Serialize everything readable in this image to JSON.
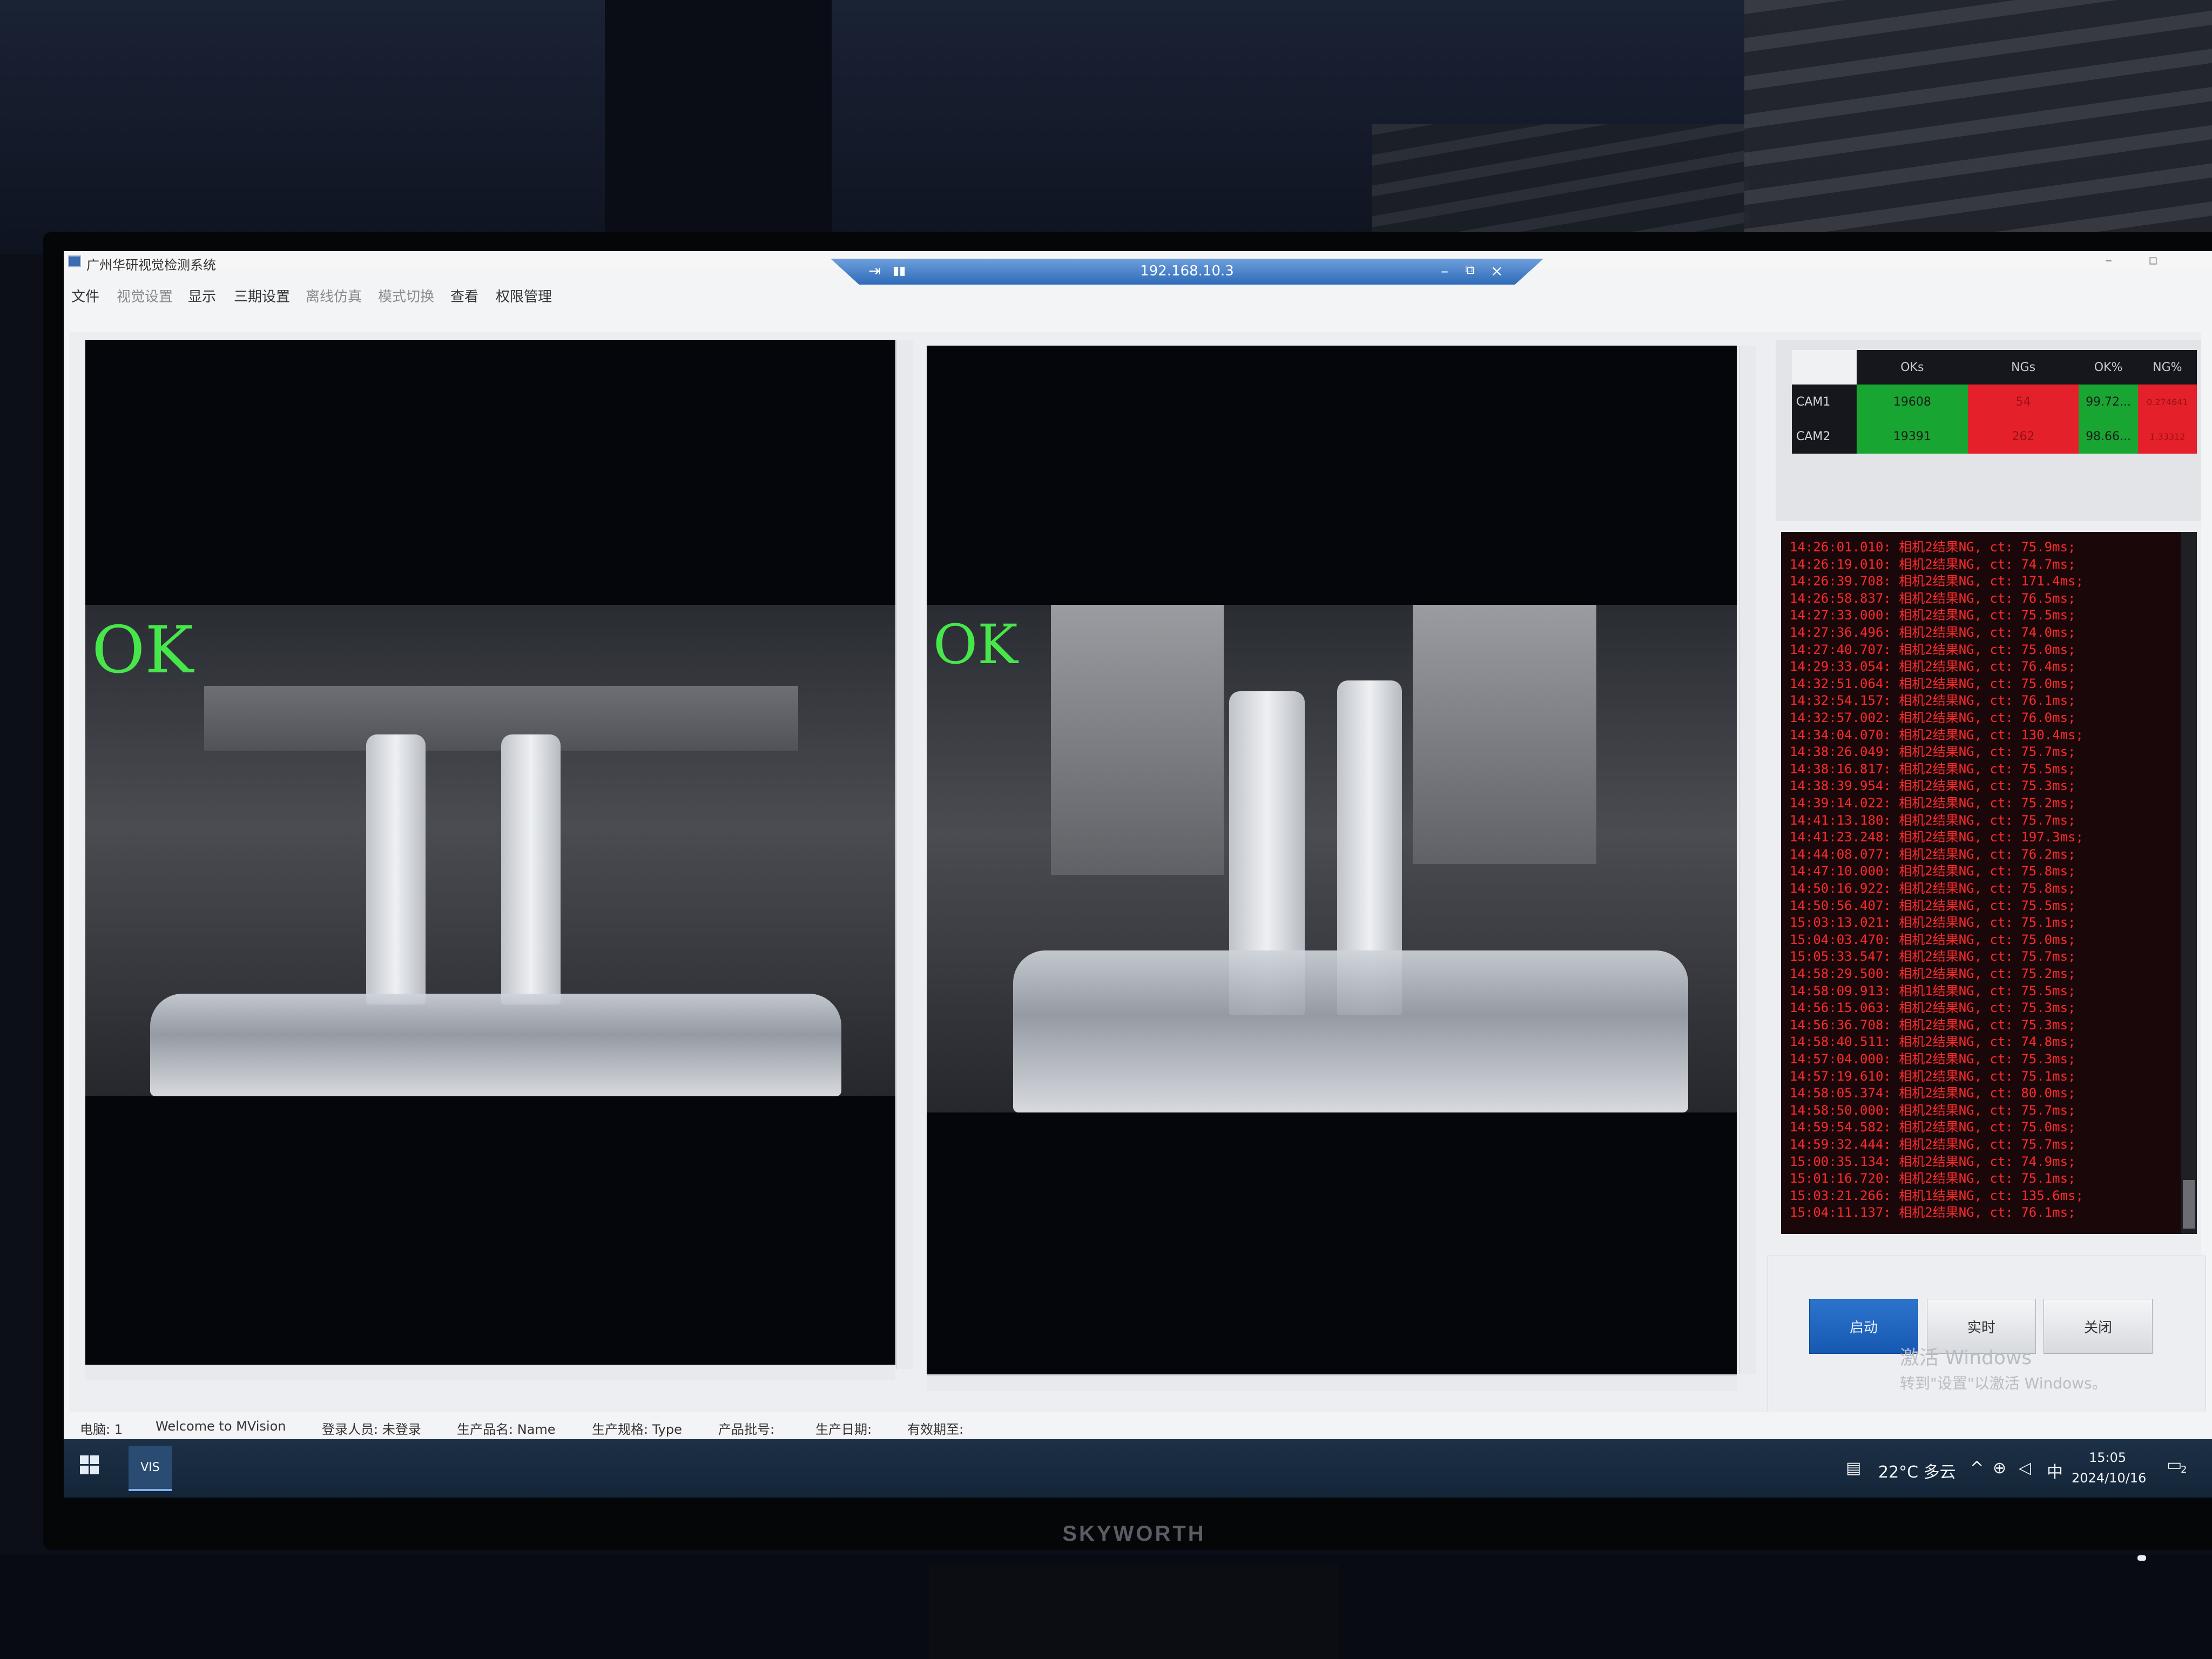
{
  "app": {
    "title": "广州华研视觉检测系统",
    "remote_ip": "192.168.10.3"
  },
  "menu": {
    "items": [
      "文件",
      "视觉设置",
      "显示",
      "三期设置",
      "离线仿真",
      "模式切换",
      "查看",
      "权限管理"
    ]
  },
  "cameras": [
    {
      "result_label": "OK"
    },
    {
      "result_label": "OK"
    }
  ],
  "stats": {
    "headers": [
      "OKs",
      "NGs",
      "OK%",
      "NG%"
    ],
    "rows": [
      {
        "name": "CAM1",
        "oks": "19608",
        "ngs": "54",
        "ok_pct": "99.72...",
        "ng_pct": "0.274641"
      },
      {
        "name": "CAM2",
        "oks": "19391",
        "ngs": "262",
        "ok_pct": "98.66...",
        "ng_pct": "1.33312"
      }
    ]
  },
  "log": {
    "lines": [
      "14:26:01.010: 相机2结果NG, ct: 75.9ms;",
      "14:26:19.010: 相机2结果NG, ct: 74.7ms;",
      "14:26:39.708: 相机2结果NG, ct: 171.4ms;",
      "14:26:58.837: 相机2结果NG, ct: 76.5ms;",
      "14:27:33.000: 相机2结果NG, ct: 75.5ms;",
      "14:27:36.496: 相机2结果NG, ct: 74.0ms;",
      "14:27:40.707: 相机2结果NG, ct: 75.0ms;",
      "14:29:33.054: 相机2结果NG, ct: 76.4ms;",
      "14:32:51.064: 相机2结果NG, ct: 75.0ms;",
      "14:32:54.157: 相机2结果NG, ct: 76.1ms;",
      "14:32:57.002: 相机2结果NG, ct: 76.0ms;",
      "14:34:04.070: 相机2结果NG, ct: 130.4ms;",
      "14:38:26.049: 相机2结果NG, ct: 75.7ms;",
      "14:38:16.817: 相机2结果NG, ct: 75.5ms;",
      "14:38:39.954: 相机2结果NG, ct: 75.3ms;",
      "14:39:14.022: 相机2结果NG, ct: 75.2ms;",
      "14:41:13.180: 相机2结果NG, ct: 75.7ms;",
      "14:41:23.248: 相机2结果NG, ct: 197.3ms;",
      "14:44:08.077: 相机2结果NG, ct: 76.2ms;",
      "14:47:10.000: 相机2结果NG, ct: 75.8ms;",
      "14:50:16.922: 相机2结果NG, ct: 75.8ms;",
      "14:50:56.407: 相机2结果NG, ct: 75.5ms;",
      "15:03:13.021: 相机2结果NG, ct: 75.1ms;",
      "15:04:03.470: 相机2结果NG, ct: 75.0ms;",
      "15:05:33.547: 相机2结果NG, ct: 75.7ms;",
      "14:58:29.500: 相机2结果NG, ct: 75.2ms;",
      "14:58:09.913: 相机1结果NG, ct: 75.5ms;",
      "14:56:15.063: 相机2结果NG, ct: 75.3ms;",
      "14:56:36.708: 相机2结果NG, ct: 75.3ms;",
      "14:58:40.511: 相机2结果NG, ct: 74.8ms;",
      "14:57:04.000: 相机2结果NG, ct: 75.3ms;",
      "14:57:19.610: 相机2结果NG, ct: 75.1ms;",
      "14:58:05.374: 相机2结果NG, ct: 80.0ms;",
      "14:58:50.000: 相机2结果NG, ct: 75.7ms;",
      "14:59:54.582: 相机2结果NG, ct: 75.0ms;",
      "14:59:32.444: 相机2结果NG, ct: 75.7ms;",
      "15:00:35.134: 相机2结果NG, ct: 74.9ms;",
      "15:01:16.720: 相机2结果NG, ct: 75.1ms;",
      "15:03:21.266: 相机1结果NG, ct: 135.6ms;",
      "15:04:11.137: 相机2结果NG, ct: 76.1ms;"
    ]
  },
  "buttons": {
    "start": "启动",
    "realtime": "实时",
    "close": "关闭"
  },
  "watermark": {
    "line1": "激活 Windows",
    "line2": "转到\"设置\"以激活 Windows。"
  },
  "status": {
    "computer": "电脑: 1",
    "welcome": "Welcome to MVision",
    "user": "登录人员: 未登录",
    "product_name": "生产品名: Name",
    "product_spec": "生产规格: Type",
    "batch": "产品批号:",
    "prod_date": "生产日期:",
    "expiry": "有效期至:"
  },
  "taskbar": {
    "app_label": "VIS",
    "weather": "22°C 多云",
    "ime": "中",
    "time": "15:05",
    "date": "2024/10/16",
    "notifications": "2"
  },
  "monitor": {
    "brand": "SKYWORTH"
  },
  "colors": {
    "ok_green": "#47e64a",
    "cell_green": "#18a531",
    "cell_red": "#e4212a",
    "log_red": "#ff2a2a",
    "start_blue": "#1659b3"
  }
}
